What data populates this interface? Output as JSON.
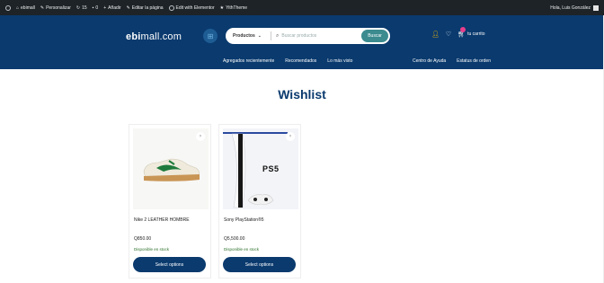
{
  "adminbar": {
    "items": [
      "ebimall",
      "Personalizar",
      "15",
      "0",
      "Añadir",
      "Editar la página",
      "Edit with Elementor",
      "YithTheme"
    ],
    "greeting": "Hola, Luis González"
  },
  "header": {
    "logo_prefix": "ebi",
    "logo_suffix": "mall.com",
    "search": {
      "category": "Productos",
      "placeholder": "Buscar productos",
      "button": "Buscar"
    },
    "cart_label": "tu carrito",
    "nav_left": [
      "Agregados recientemente",
      "Recomendados",
      "Lo más visto"
    ],
    "nav_right": [
      "Centro de Ayuda",
      "Estatus de orden"
    ]
  },
  "page": {
    "title": "Wishlist"
  },
  "products": [
    {
      "name": "Nike 2 LEATHER HOMBRE",
      "price": "Q850.00",
      "stock": "Disponible en stock",
      "button": "Select options",
      "remove": "×"
    },
    {
      "name": "Sony PlayStation®5",
      "price": "Q5,500.00",
      "stock": "Disponible en stock",
      "button": "Select options",
      "remove": "×",
      "brand": "PS5"
    }
  ],
  "colors": {
    "header_bg": "#0a3a6e",
    "button_bg": "#0a3a6e",
    "search_button": "#3b8b8f"
  }
}
